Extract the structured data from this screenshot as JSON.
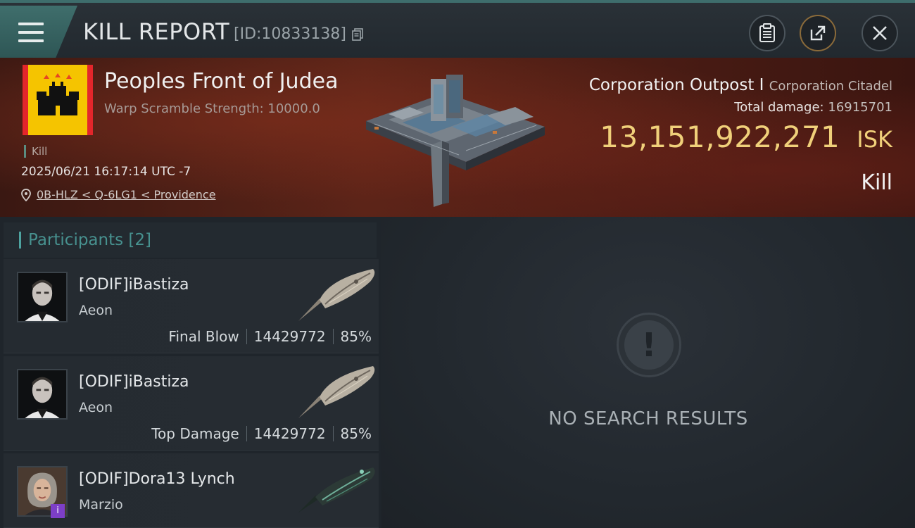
{
  "header": {
    "title": "KILL REPORT",
    "report_id": "[ID:10833138]",
    "icons": [
      "menu-icon",
      "copy-icon",
      "clipboard-icon",
      "share-icon",
      "close-icon"
    ]
  },
  "victim": {
    "name": "Peoples Front of Judea",
    "warp_info": "Warp Scramble Strength: 10000.0",
    "tag": "Kill",
    "datetime": "2025/06/21 16:17:14 UTC -7",
    "location": "0B-HLZ < Q-6LG1 < Providence",
    "ship_name": "Corporation Outpost I",
    "ship_class": "Corporation Citadel",
    "total_damage_label": "Total damage:",
    "total_damage": "16915701",
    "isk_value": "13,151,922,271",
    "isk_unit": "ISK",
    "result": "Kill",
    "colors": {
      "logo_bg": "#f5c400",
      "logo_frame": "#e3262b",
      "isk": "#f0d07a"
    }
  },
  "participants": {
    "label": "Participants",
    "count": "[2]",
    "rows": [
      {
        "name": "[ODIF]iBastiza",
        "ship": "Aeon",
        "role": "Final Blow",
        "damage": "14429772",
        "percent": "85%"
      },
      {
        "name": "[ODIF]iBastiza",
        "ship": "Aeon",
        "role": "Top Damage",
        "damage": "14429772",
        "percent": "85%"
      },
      {
        "name": "[ODIF]Dora13 Lynch",
        "ship": "Marzio",
        "badge": "i"
      }
    ]
  },
  "results": {
    "empty_text": "NO SEARCH RESULTS"
  }
}
